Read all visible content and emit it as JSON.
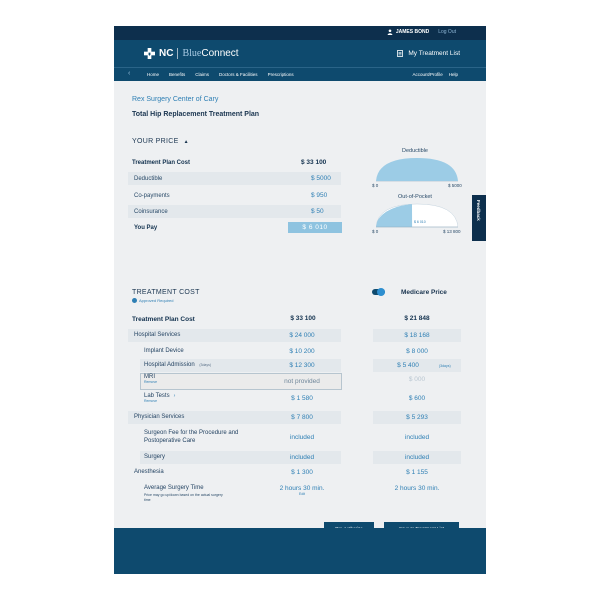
{
  "header": {
    "user_name": "JAMES BOND",
    "logout": "Log Out",
    "logo_nc": "NC",
    "logo_blue": "Blue",
    "logo_connect": "Connect",
    "my_list": "My Treatment List"
  },
  "nav": {
    "left": [
      "Home",
      "Benefits",
      "Claims",
      "Doctors & Facilities",
      "Prescriptions"
    ],
    "right": [
      "Account/Profile",
      "Help"
    ]
  },
  "provider": "Rex Surgery Center of Cary",
  "plan_title": "Total Hip Replacement Treatment Plan",
  "your_price": {
    "label": "YOUR PRICE",
    "cost_label": "Treatment Plan Cost",
    "cost_value": "$ 33 100",
    "rows": [
      {
        "label": "Deductible",
        "value": "$ 5000"
      },
      {
        "label": "Co-payments",
        "value": "$ 950"
      },
      {
        "label": "Coinsurance",
        "value": "$ 50"
      }
    ],
    "you_pay_label": "You Pay",
    "you_pay_value": "$ 6 010"
  },
  "charts": {
    "deductible": {
      "title": "Deductible",
      "min": "$ 0",
      "max": "$ 5000",
      "fill": 1.0
    },
    "out_of_pocket": {
      "title": "Out-of-Pocket",
      "min": "$ 0",
      "max": "$ 13 800",
      "marker": "$ 6 010",
      "fill": 0.44
    }
  },
  "feedback": "Feedback",
  "treatment_cost": {
    "label": "TREATMENT COST",
    "approved": "Approved Required",
    "medicare_toggle_label": "Medicare Price",
    "cost_label": "Treatment Plan Cost",
    "cost_value": "$ 33 100",
    "medicare_cost_value": "$ 21 848",
    "rows": [
      {
        "label": "Hospital Services",
        "value": "$ 24 000",
        "medicare": "$ 18 168"
      },
      {
        "label": "Implant Device",
        "value": "$ 10 200",
        "medicare": "$ 8 000"
      },
      {
        "label": "Hospital Admission",
        "tag": "(3days)",
        "value": "$ 12 300",
        "medicare": "$ 5 400",
        "medicare_tag": "(3days)"
      },
      {
        "label": "MRI",
        "sub": "Remove",
        "value": "not provided",
        "medicare": "$ 000"
      },
      {
        "label": "Lab Tests",
        "sub": "Remove",
        "value": "$ 1 580",
        "medicare": "$ 600"
      },
      {
        "label": "Physician Services",
        "value": "$ 7 800",
        "medicare": "$ 5 293"
      },
      {
        "label": "Surgeon Fee for the Procedure and Postoperative Care",
        "value": "included",
        "medicare": "included"
      },
      {
        "label": "Surgery",
        "value": "included",
        "medicare": "included"
      },
      {
        "label": "Anesthesia",
        "value": "$ 1 300",
        "medicare": "$ 1 155"
      },
      {
        "label": "Average Surgery Time",
        "note": "Price may go up/down based on the actual surgery time",
        "value": "2 hours 30 min.",
        "value_sub": "Edit",
        "medicare": "2 hours 30 min."
      }
    ]
  },
  "buttons": {
    "pre_auth": "Pre-Authorize",
    "pre_auth_note": "Submit your request to make sure your health plan approves treatment",
    "save": "Save to Treatment List"
  },
  "colors": {
    "brand_dark": "#0d2f4d",
    "brand": "#0e4a6e",
    "accent": "#2e7fb4",
    "chart_fill": "#9ccce6"
  }
}
